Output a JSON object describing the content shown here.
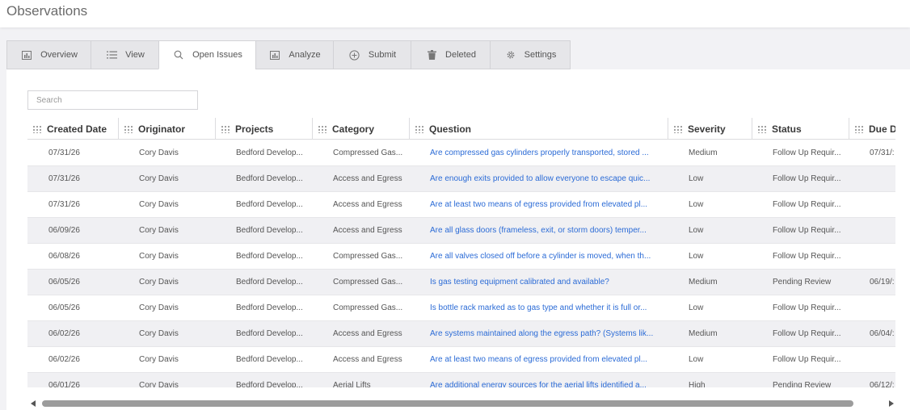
{
  "app": {
    "title": "Observations"
  },
  "tabs": [
    {
      "label": "Overview",
      "icon": "chart-icon"
    },
    {
      "label": "View",
      "icon": "list-icon"
    },
    {
      "label": "Open Issues",
      "icon": "search-icon",
      "active": true
    },
    {
      "label": "Analyze",
      "icon": "chart-icon"
    },
    {
      "label": "Submit",
      "icon": "plus-circle-icon"
    },
    {
      "label": "Deleted",
      "icon": "trash-icon"
    },
    {
      "label": "Settings",
      "icon": "gear-icon"
    }
  ],
  "search": {
    "placeholder": "Search",
    "value": ""
  },
  "table": {
    "columns": [
      "Created Date",
      "Originator",
      "Projects",
      "Category",
      "Question",
      "Severity",
      "Status",
      "Due D"
    ],
    "rows": [
      [
        "07/31/26",
        "Cory Davis",
        "Bedford Develop...",
        "Compressed Gas...",
        "Are compressed gas cylinders properly transported, stored ...",
        "Medium",
        "Follow Up Requir...",
        "07/31/:"
      ],
      [
        "07/31/26",
        "Cory Davis",
        "Bedford Develop...",
        "Access and Egress",
        "Are enough exits provided to allow everyone to escape quic...",
        "Low",
        "Follow Up Requir...",
        ""
      ],
      [
        "07/31/26",
        "Cory Davis",
        "Bedford Develop...",
        "Access and Egress",
        "Are at least two means of egress provided from elevated pl...",
        "Low",
        "Follow Up Requir...",
        ""
      ],
      [
        "06/09/26",
        "Cory Davis",
        "Bedford Develop...",
        "Access and Egress",
        "Are all glass doors (frameless, exit, or storm doors) temper...",
        "Low",
        "Follow Up Requir...",
        ""
      ],
      [
        "06/08/26",
        "Cory Davis",
        "Bedford Develop...",
        "Compressed Gas...",
        "Are all valves closed off before a cylinder is moved, when th...",
        "Low",
        "Follow Up Requir...",
        ""
      ],
      [
        "06/05/26",
        "Cory Davis",
        "Bedford Develop...",
        "Compressed Gas...",
        "Is gas testing equipment calibrated and available?",
        "Medium",
        "Pending Review",
        "06/19/:"
      ],
      [
        "06/05/26",
        "Cory Davis",
        "Bedford Develop...",
        "Compressed Gas...",
        "Is bottle rack marked as to gas type and whether it is full or...",
        "Low",
        "Follow Up Requir...",
        ""
      ],
      [
        "06/02/26",
        "Cory Davis",
        "Bedford Develop...",
        "Access and Egress",
        "Are systems maintained along the egress path? (Systems lik...",
        "Medium",
        "Follow Up Requir...",
        "06/04/:"
      ],
      [
        "06/02/26",
        "Cory Davis",
        "Bedford Develop...",
        "Access and Egress",
        "Are at least two means of egress provided from elevated pl...",
        "Low",
        "Follow Up Requir...",
        ""
      ],
      [
        "06/01/26",
        "Cory Davis",
        "Bedford Develop...",
        "Aerial Lifts",
        "Are additional energy sources for the aerial lifts identified a...",
        "High",
        "Pending Review",
        "06/12/:"
      ]
    ]
  },
  "colors": {
    "link": "#2b6bd6",
    "row_alt": "#f0f0f3",
    "tab_bg": "#e6e6e9",
    "page_bg": "#f2f2f5"
  }
}
